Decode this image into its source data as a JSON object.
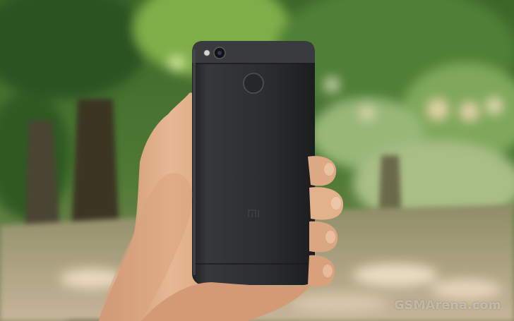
{
  "photo": {
    "subject": "smartphone-back-held-in-hand",
    "watermark": "GSMArena.com",
    "colors": {
      "foliage": "#3f6b2a",
      "phone_body": "#2b2c2e",
      "skin": "#e0b08c",
      "ground": "#c9b79a"
    }
  }
}
